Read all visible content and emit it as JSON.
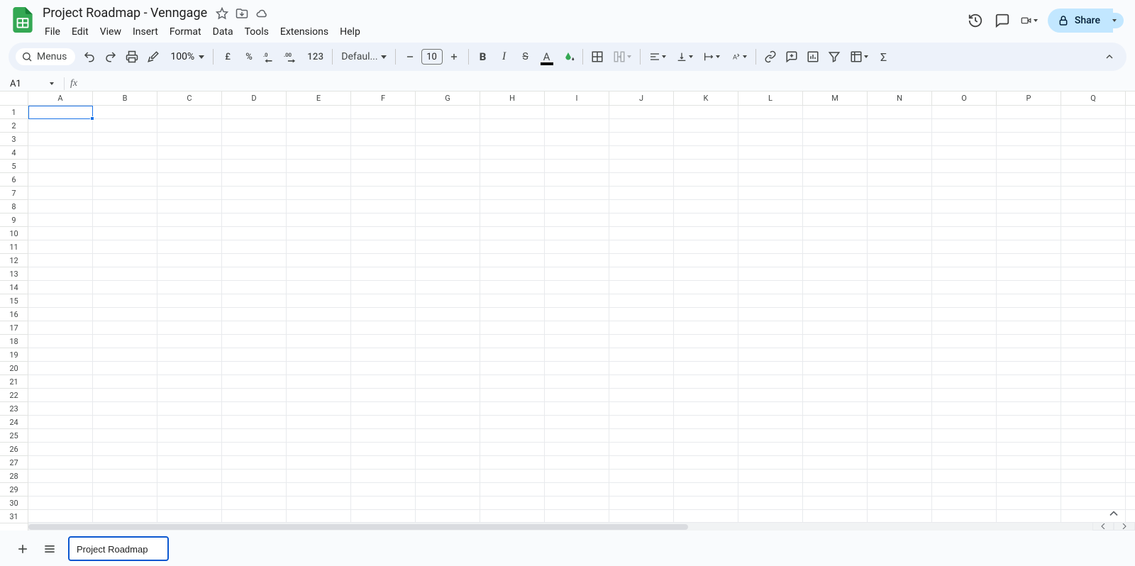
{
  "doc": {
    "title": "Project Roadmap - Venngage"
  },
  "menubar": [
    "File",
    "Edit",
    "View",
    "Insert",
    "Format",
    "Data",
    "Tools",
    "Extensions",
    "Help"
  ],
  "header": {
    "share_label": "Share"
  },
  "toolbar": {
    "menus_label": "Menus",
    "zoom": "100%",
    "currency_symbol": "£",
    "number_123": "123",
    "font": "Defaul...",
    "font_size": "10"
  },
  "namebox": {
    "value": "A1"
  },
  "columns": [
    "A",
    "B",
    "C",
    "D",
    "E",
    "F",
    "G",
    "H",
    "I",
    "J",
    "K",
    "L",
    "M",
    "N",
    "O",
    "P",
    "Q"
  ],
  "rows": [
    "1",
    "2",
    "3",
    "4",
    "5",
    "6",
    "7",
    "8",
    "9",
    "10",
    "11",
    "12",
    "13",
    "14",
    "15",
    "16",
    "17",
    "18",
    "19",
    "20",
    "21",
    "22",
    "23",
    "24",
    "25",
    "26",
    "27",
    "28",
    "29",
    "30",
    "31"
  ],
  "sheet": {
    "editing_name": "Project Roadmap"
  }
}
